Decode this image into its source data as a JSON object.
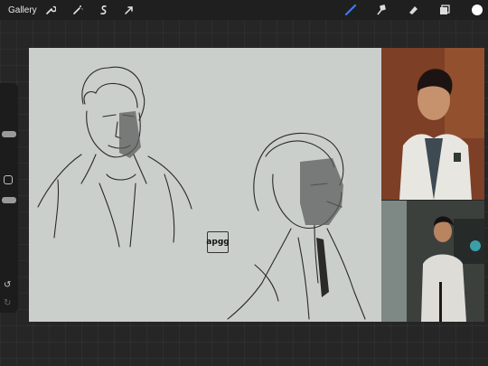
{
  "topbar": {
    "gallery_label": "Gallery",
    "tools_left": [
      "wrench-icon",
      "magic-wand-icon",
      "selection-icon",
      "transform-arrow-icon"
    ],
    "tools_right": [
      "brush-icon",
      "smudge-icon",
      "eraser-icon",
      "layers-icon",
      "color-swatch-icon"
    ],
    "accent_color": "#3a7bf7",
    "color_swatch": "#ffffff"
  },
  "canvas": {
    "signature_text": "apgg",
    "background": "#cbcfcc"
  },
  "reference_images": [
    "portrait-photo-white-robe",
    "photo-man-in-room"
  ]
}
